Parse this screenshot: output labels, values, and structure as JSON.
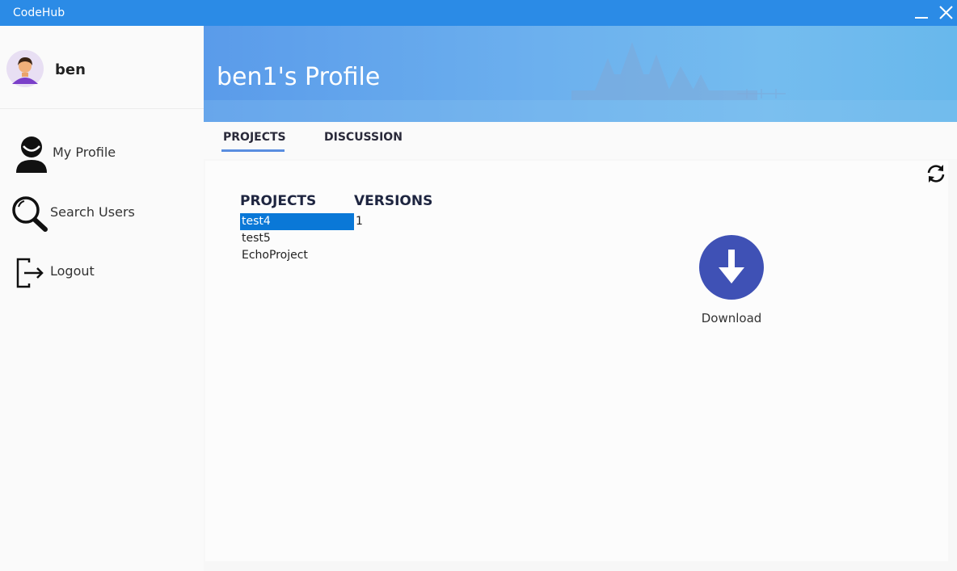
{
  "window": {
    "title": "CodeHub"
  },
  "sidebar": {
    "username": "ben",
    "items": [
      {
        "label": "My Profile",
        "icon": "user-icon"
      },
      {
        "label": "Search Users",
        "icon": "search-icon"
      },
      {
        "label": "Logout",
        "icon": "logout-icon"
      }
    ]
  },
  "banner": {
    "title": "ben1's Profile"
  },
  "tabs": [
    {
      "label": "PROJECTS",
      "active": true
    },
    {
      "label": "DISCUSSION",
      "active": false
    }
  ],
  "projects": {
    "header_projects": "PROJECTS",
    "header_versions": "VERSIONS",
    "items": [
      "test4",
      "test5",
      "EchoProject"
    ],
    "selected_index": 0,
    "versions": [
      "1"
    ]
  },
  "download": {
    "label": "Download"
  },
  "colors": {
    "titlebar": "#2b8be6",
    "accent": "#3f51b5",
    "selection": "#0a78d7"
  }
}
